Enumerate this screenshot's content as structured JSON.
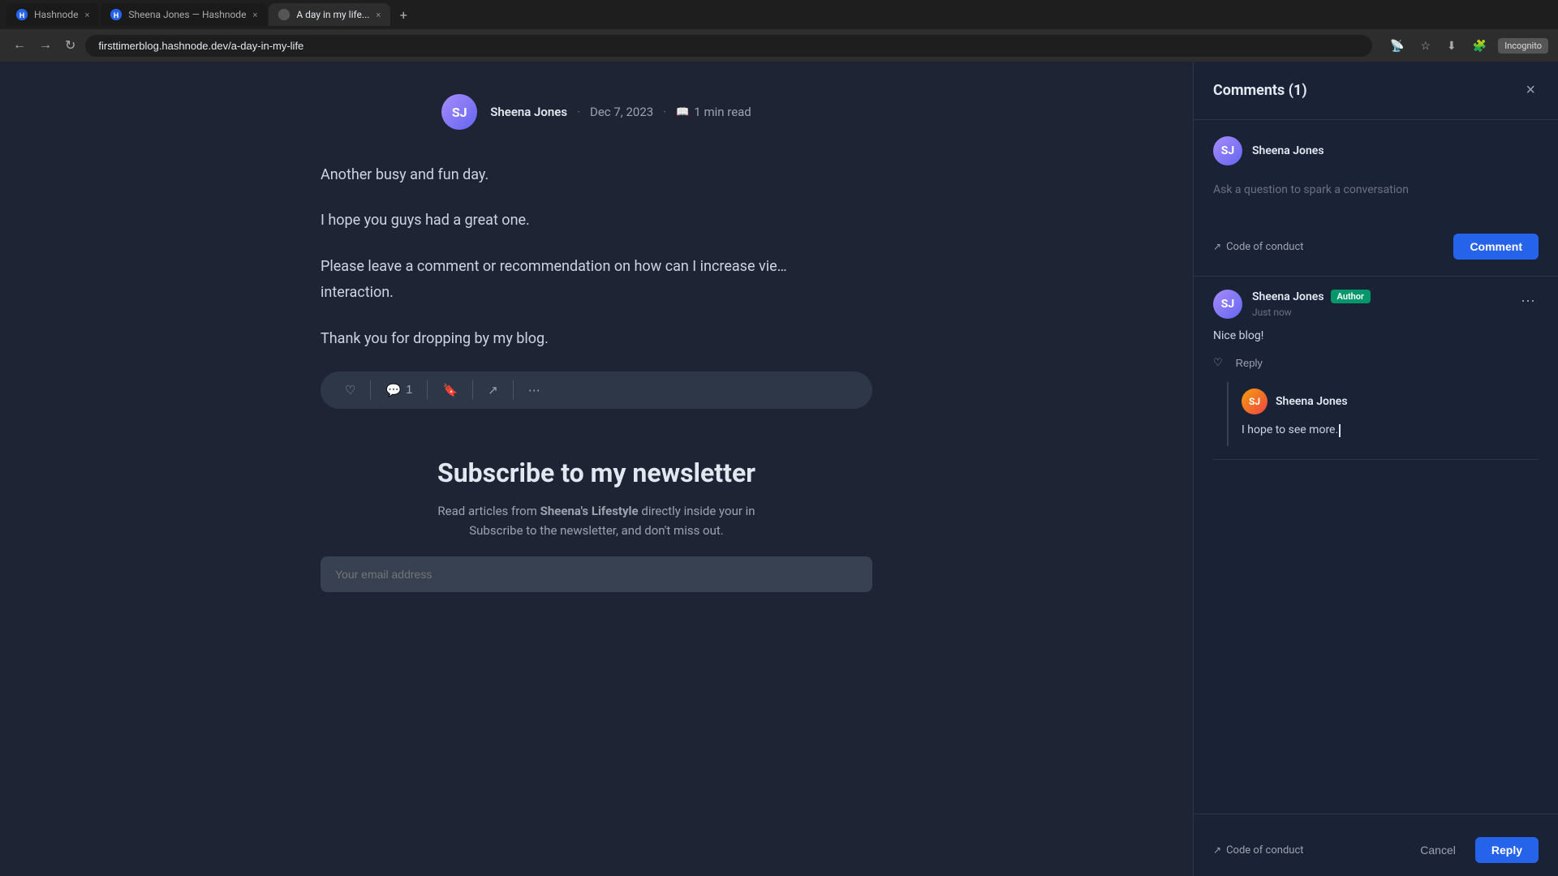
{
  "browser": {
    "tabs": [
      {
        "id": "hashnode",
        "label": "Hashnode",
        "favicon": "hashnode",
        "active": false
      },
      {
        "id": "sheena",
        "label": "Sheena Jones — Hashnode",
        "favicon": "sheena",
        "active": false
      },
      {
        "id": "aday",
        "label": "A day in my life...",
        "favicon": "aday",
        "active": true
      }
    ],
    "url": "firsttimerblog.hashnode.dev/a-day-in-my-life",
    "incognito_label": "Incognito"
  },
  "post": {
    "author": "Sheena Jones",
    "author_initials": "SJ",
    "date": "Dec 7, 2023",
    "read_time": "1 min read",
    "paragraphs": [
      "Another busy and fun day.",
      "I hope you guys had a great one.",
      "Please leave a comment or recommendation on how can I increase vie…\ninteraction.",
      "Thank you for dropping by my blog."
    ],
    "action_bar": {
      "like_icon": "♡",
      "comment_icon": "💬",
      "comment_count": "1",
      "bookmark_icon": "🔖",
      "share_icon": "⟳",
      "more_icon": "⋯"
    }
  },
  "newsletter": {
    "title": "Subscribe to my newsletter",
    "description_part1": "Read articles from ",
    "description_bold": "Sheena's Lifestyle",
    "description_part2": " directly inside your in\nSubscribe to the newsletter, and don't miss out."
  },
  "comments": {
    "title": "Comments",
    "count": "1",
    "close_icon": "×",
    "compose": {
      "user_name": "Sheena Jones",
      "user_initials": "SJ",
      "placeholder": "Ask a question to spark a conversation",
      "code_of_conduct": "Code of conduct",
      "submit_label": "Comment"
    },
    "items": [
      {
        "id": "comment-1",
        "author": "Sheena Jones",
        "author_initials": "SJ",
        "author_badge": "Author",
        "time": "Just now",
        "text": "Nice blog!",
        "like_icon": "♡",
        "reply_label": "Reply",
        "more_icon": "⋯",
        "replies": [
          {
            "id": "reply-1",
            "author": "Sheena Jones",
            "author_initials": "SJ",
            "text": "I hope to see more.",
            "has_cursor": true
          }
        ]
      }
    ],
    "reply_compose": {
      "code_of_conduct": "Code of conduct",
      "cancel_label": "Cancel",
      "submit_label": "Reply"
    }
  }
}
